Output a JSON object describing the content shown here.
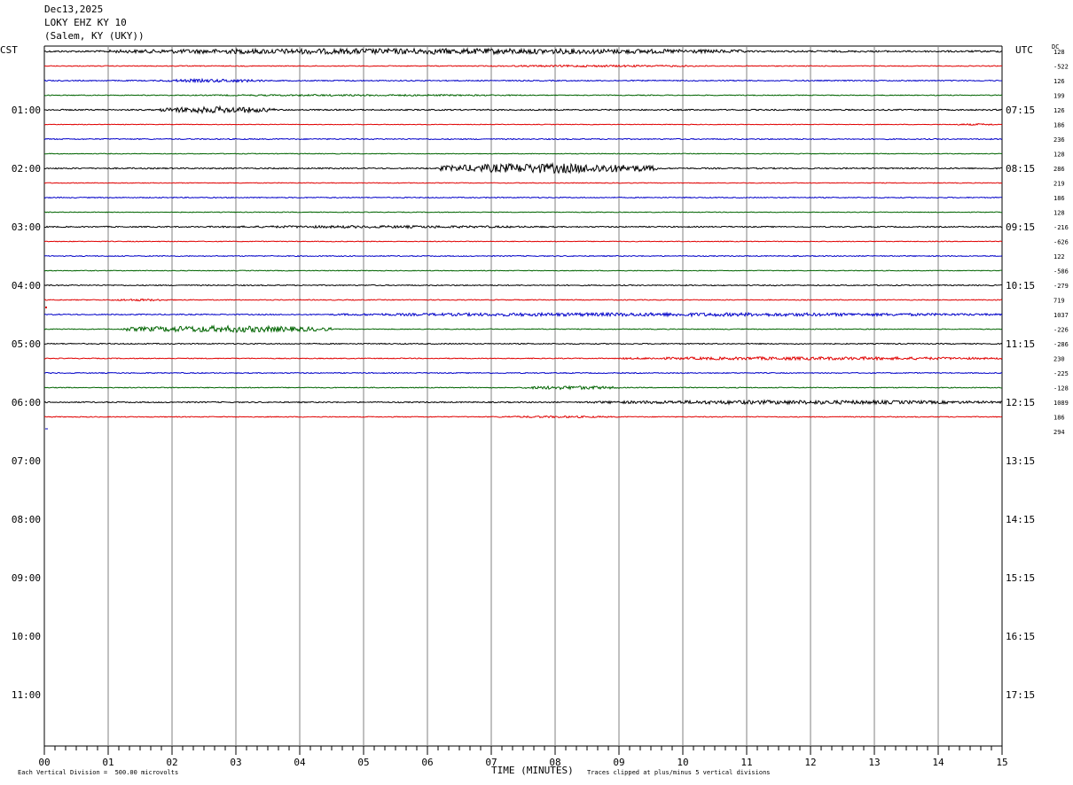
{
  "header": {
    "date": "Dec13,2025",
    "station": "LOKY EHZ KY 10",
    "location": "(Salem, KY (UKY))"
  },
  "axis_labels": {
    "left_timezone": "CST",
    "right_timezone": "UTC",
    "dc_label": "DC",
    "xlabel": "TIME (MINUTES)",
    "scale_note": "Each Vertical Division =  500.00 microvolts",
    "clip_note": "Traces clipped at plus/minus 5 vertical divisions"
  },
  "chart_data": {
    "type": "line",
    "title": "LOKY EHZ KY 10",
    "xlabel": "TIME (MINUTES)",
    "xlim": [
      0,
      15
    ],
    "x_ticks": [
      "00",
      "01",
      "02",
      "03",
      "04",
      "05",
      "06",
      "07",
      "08",
      "09",
      "10",
      "11",
      "12",
      "13",
      "14",
      "15"
    ],
    "trace_interval_minutes": 15,
    "traces_recorded": 26,
    "trace_colors": [
      "#000000",
      "#e00000",
      "#0000c8",
      "#006400"
    ],
    "left_hour_labels": [
      "01:00",
      "02:00",
      "03:00",
      "04:00",
      "05:00",
      "06:00",
      "07:00",
      "08:00",
      "09:00",
      "10:00",
      "11:00"
    ],
    "right_hour_labels": [
      "07:15",
      "08:15",
      "09:15",
      "10:15",
      "11:15",
      "12:15",
      "13:15",
      "14:15",
      "15:15",
      "16:15",
      "17:15"
    ],
    "dc_offsets": [
      "128",
      "-522",
      "126",
      "199",
      "126",
      "186",
      "236",
      "128",
      "286",
      "219",
      "186",
      "128",
      "-216",
      "-626",
      "122",
      "-586",
      "-279",
      "719",
      "1037",
      "-226",
      "-286",
      "230",
      "-225",
      "-128",
      "1089",
      "186",
      "294"
    ],
    "activity": [
      {
        "trace": 0,
        "amp": 1.6,
        "bursts": [
          [
            1.0,
            11.0,
            2.0
          ]
        ]
      },
      {
        "trace": 1,
        "amp": 0.8,
        "bursts": [
          [
            7.0,
            10.5,
            1.4
          ]
        ]
      },
      {
        "trace": 2,
        "amp": 1.0,
        "bursts": [
          [
            1.8,
            3.5,
            1.8
          ]
        ]
      },
      {
        "trace": 3,
        "amp": 0.8,
        "bursts": [
          [
            2.0,
            8.0,
            1.2
          ]
        ]
      },
      {
        "trace": 4,
        "amp": 1.2,
        "bursts": [
          [
            1.8,
            3.6,
            3.0
          ]
        ]
      },
      {
        "trace": 5,
        "amp": 0.6,
        "bursts": [
          [
            14.2,
            15.0,
            1.6
          ]
        ]
      },
      {
        "trace": 6,
        "amp": 1.0,
        "bursts": []
      },
      {
        "trace": 7,
        "amp": 0.7,
        "bursts": []
      },
      {
        "trace": 8,
        "amp": 1.2,
        "bursts": [
          [
            6.2,
            9.6,
            4.5
          ]
        ]
      },
      {
        "trace": 9,
        "amp": 0.7,
        "bursts": []
      },
      {
        "trace": 10,
        "amp": 0.9,
        "bursts": []
      },
      {
        "trace": 11,
        "amp": 0.7,
        "bursts": []
      },
      {
        "trace": 12,
        "amp": 1.1,
        "bursts": [
          [
            2.5,
            8.0,
            1.3
          ]
        ]
      },
      {
        "trace": 13,
        "amp": 0.7,
        "bursts": []
      },
      {
        "trace": 14,
        "amp": 0.9,
        "bursts": []
      },
      {
        "trace": 15,
        "amp": 0.7,
        "bursts": []
      },
      {
        "trace": 16,
        "amp": 1.0,
        "bursts": []
      },
      {
        "trace": 17,
        "amp": 0.8,
        "bursts": [
          [
            1.0,
            2.0,
            1.5
          ]
        ]
      },
      {
        "trace": 18,
        "amp": 1.0,
        "bursts": [
          [
            4.5,
            15.0,
            2.0
          ]
        ]
      },
      {
        "trace": 19,
        "amp": 0.8,
        "bursts": [
          [
            1.2,
            4.5,
            4.5
          ]
        ]
      },
      {
        "trace": 20,
        "amp": 1.0,
        "bursts": []
      },
      {
        "trace": 21,
        "amp": 0.8,
        "bursts": [
          [
            9.0,
            15.0,
            2.2
          ]
        ]
      },
      {
        "trace": 22,
        "amp": 0.9,
        "bursts": []
      },
      {
        "trace": 23,
        "amp": 0.8,
        "bursts": [
          [
            7.5,
            9.0,
            2.5
          ]
        ]
      },
      {
        "trace": 24,
        "amp": 1.1,
        "bursts": [
          [
            8.5,
            15.0,
            2.0
          ]
        ]
      },
      {
        "trace": 25,
        "amp": 0.8,
        "bursts": [
          [
            7.0,
            9.0,
            1.4
          ]
        ]
      }
    ]
  }
}
